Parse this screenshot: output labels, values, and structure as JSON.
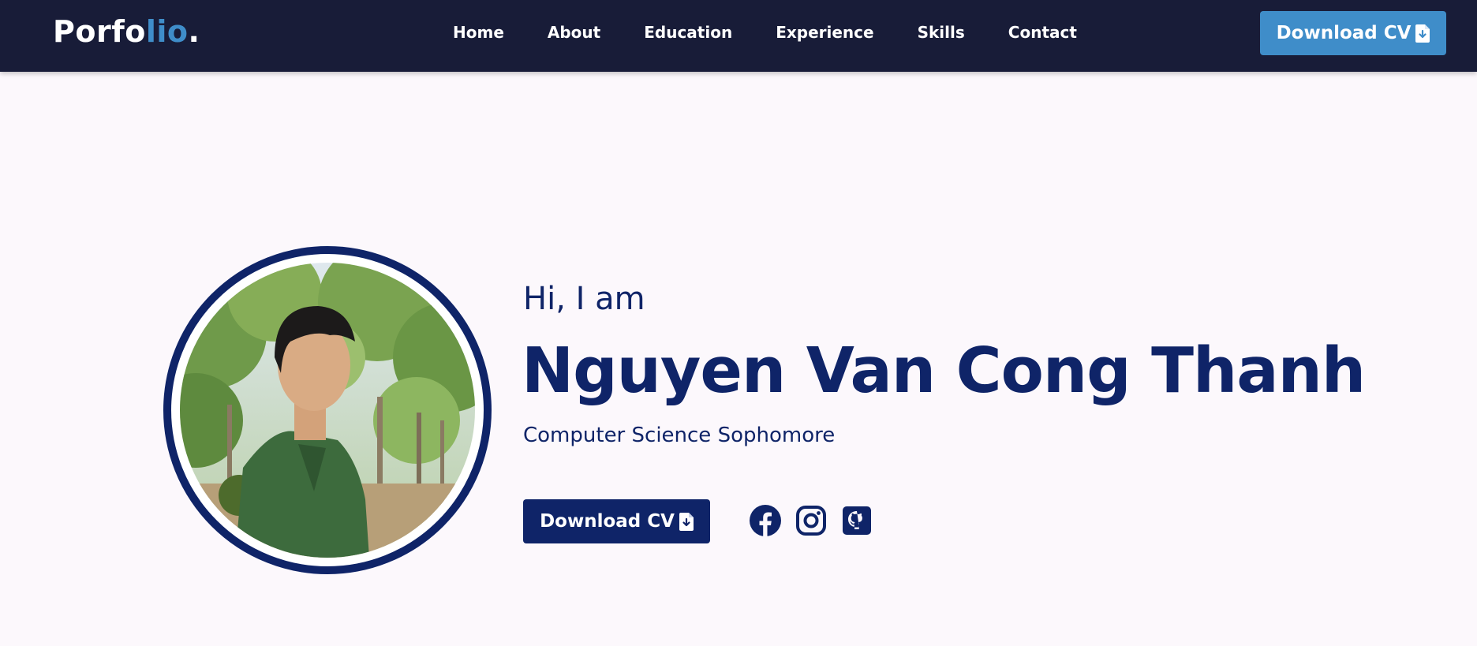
{
  "header": {
    "logo": {
      "main": "Porfo",
      "accent": "lio",
      "suffix": "."
    },
    "nav": [
      {
        "label": "Home"
      },
      {
        "label": "About"
      },
      {
        "label": "Education"
      },
      {
        "label": "Experience"
      },
      {
        "label": "Skills"
      },
      {
        "label": "Contact"
      }
    ],
    "cta_label": "Download CV",
    "cta_icon": "file-download-icon"
  },
  "hero": {
    "greeting": "Hi, I am",
    "name": "Nguyen Van Cong Thanh",
    "role": "Computer Science Sophomore",
    "cta_label": "Download CV",
    "cta_icon": "file-download-icon",
    "profile_photo": "profile-photo",
    "socials": [
      {
        "icon": "facebook-icon"
      },
      {
        "icon": "instagram-icon"
      },
      {
        "icon": "github-icon"
      }
    ]
  },
  "colors": {
    "navbar_bg": "#181c38",
    "accent": "#3f8dc9",
    "primary": "#0f2468",
    "page_bg": "#fcf8fc"
  }
}
